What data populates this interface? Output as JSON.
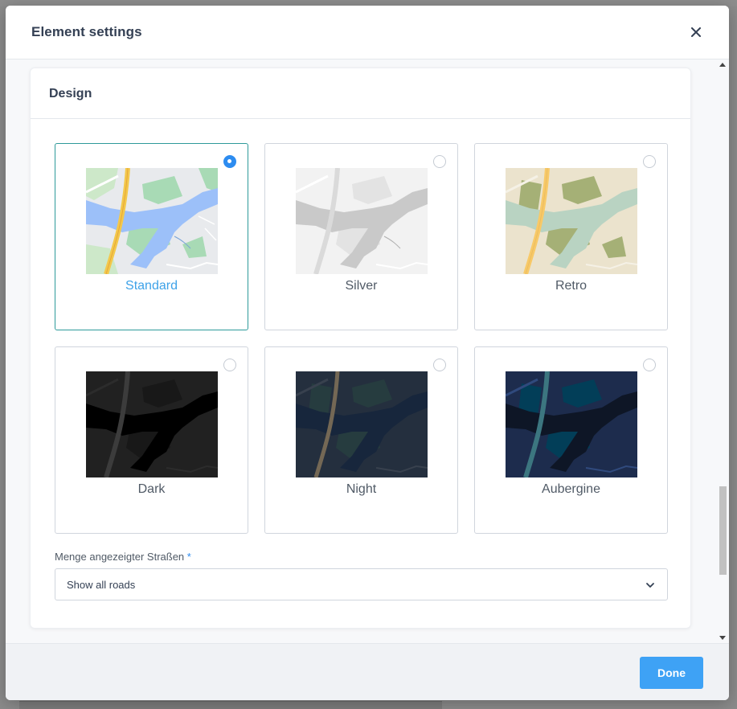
{
  "modal": {
    "title": "Element settings",
    "close_icon": "close-icon",
    "done_label": "Done"
  },
  "design": {
    "title": "Design",
    "styles": [
      {
        "id": "standard",
        "label": "Standard",
        "selected": true
      },
      {
        "id": "silver",
        "label": "Silver",
        "selected": false
      },
      {
        "id": "retro",
        "label": "Retro",
        "selected": false
      },
      {
        "id": "dark",
        "label": "Dark",
        "selected": false
      },
      {
        "id": "night",
        "label": "Night",
        "selected": false
      },
      {
        "id": "aubergine",
        "label": "Aubergine",
        "selected": false
      }
    ],
    "roads_field": {
      "label": "Menge angezeigter Straßen",
      "required_mark": "*",
      "value": "Show all roads"
    }
  },
  "colors": {
    "accent": "#3ea2f5",
    "selected_border": "#2e9a9a"
  }
}
